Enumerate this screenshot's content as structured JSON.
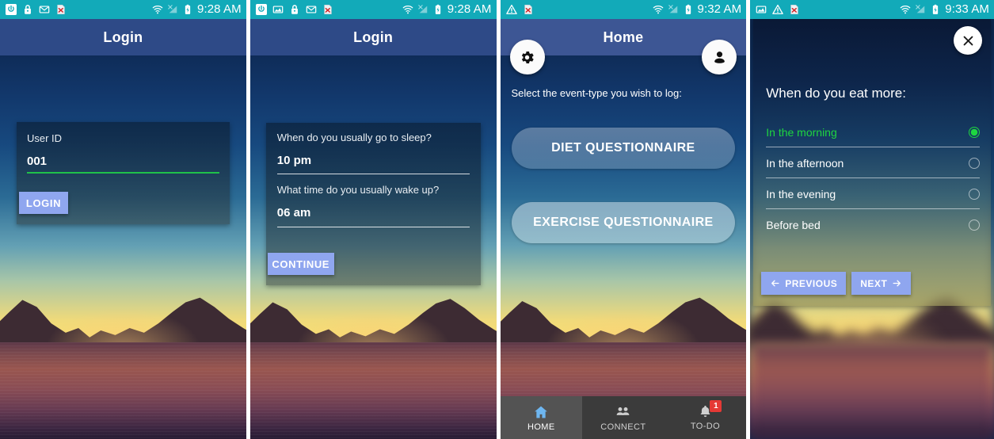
{
  "screens": [
    {
      "id": "login",
      "statusbar": {
        "left_icons": [
          "power-icon",
          "lock-icon",
          "mail-icon",
          "error-document-icon"
        ],
        "right_icons": [
          "wifi-icon",
          "signal-no-service-icon",
          "battery-charging-icon"
        ],
        "clock": "9:28 AM"
      },
      "appbar": {
        "title": "Login"
      },
      "card": {
        "field_label": "User ID",
        "field_value": "001",
        "field_placeholder": "User ID",
        "submit_label": "LOGIN"
      }
    },
    {
      "id": "sleep-questions",
      "statusbar": {
        "left_icons": [
          "power-icon",
          "image-icon",
          "lock-icon",
          "mail-icon",
          "error-document-icon"
        ],
        "right_icons": [
          "wifi-icon",
          "signal-no-service-icon",
          "battery-charging-icon"
        ],
        "clock": "9:28 AM"
      },
      "appbar": {
        "title": "Login"
      },
      "card": {
        "question_1": "When do you usually go to sleep?",
        "answer_1": "10 pm",
        "question_2": "What time do you usually wake up?",
        "answer_2": "06 am",
        "submit_label": "CONTINUE"
      }
    },
    {
      "id": "home",
      "statusbar": {
        "left_icons": [
          "warning-icon",
          "error-document-icon"
        ],
        "right_icons": [
          "wifi-icon",
          "signal-no-service-icon",
          "battery-charging-icon"
        ],
        "clock": "9:32 AM"
      },
      "appbar": {
        "title": "Home"
      },
      "settings_icon": "gear-icon",
      "profile_icon": "account-icon",
      "subtitle": "Select the event-type you wish to log:",
      "buttons": [
        {
          "label": "DIET QUESTIONNAIRE"
        },
        {
          "label": "EXERCISE QUESTIONNAIRE"
        }
      ],
      "bottom_nav": [
        {
          "label": "HOME",
          "icon": "home-icon",
          "active": true,
          "badge": ""
        },
        {
          "label": "CONNECT",
          "icon": "people-icon",
          "active": false,
          "badge": ""
        },
        {
          "label": "TO-DO",
          "icon": "bell-icon",
          "active": false,
          "badge": "1"
        }
      ]
    },
    {
      "id": "diet-question",
      "statusbar": {
        "left_icons": [
          "image-icon",
          "warning-icon",
          "error-document-icon"
        ],
        "right_icons": [
          "wifi-icon",
          "signal-no-service-icon",
          "battery-charging-icon"
        ],
        "clock": "9:33 AM"
      },
      "dialog": {
        "close_icon": "close-icon",
        "question": "When do you eat more:",
        "options": [
          {
            "label": "In the morning",
            "selected": true
          },
          {
            "label": "In the afternoon",
            "selected": false
          },
          {
            "label": "In the evening",
            "selected": false
          },
          {
            "label": "Before bed",
            "selected": false
          }
        ],
        "previous_label": "PREVIOUS",
        "next_label": "NEXT"
      }
    }
  ],
  "colors": {
    "statusbar": "#12aab9",
    "appbar": "#2e4a87",
    "accent_button": "#8fa6ef",
    "selected_green": "#1ed640",
    "underline_green": "#1fc14a",
    "badge_red": "#e53935",
    "nav_active_icon": "#6eb6f0"
  }
}
